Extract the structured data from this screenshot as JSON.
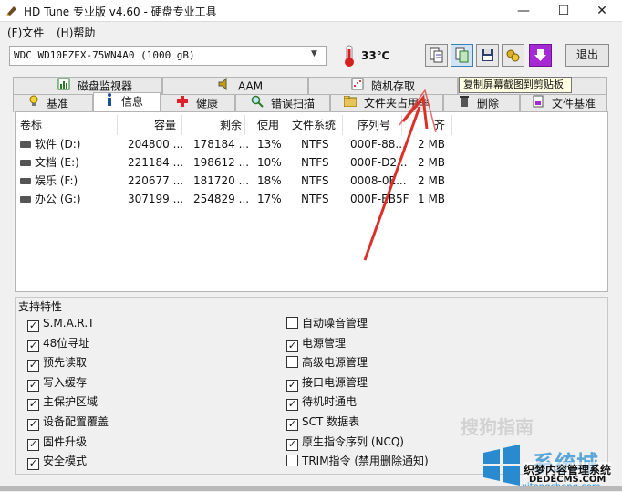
{
  "window": {
    "title": "HD Tune 专业版 v4.60 - 硬盘专业工具",
    "min": "—",
    "max": "☐",
    "close": "✕"
  },
  "menu": {
    "file": "(F)文件",
    "help": "(H)帮助"
  },
  "toolbar": {
    "drive": "WDC WD10EZEX-75WN4A0 (1000 gB)",
    "temperature": "33℃",
    "exit": "退出",
    "tooltip": "复制屏幕截图到剪贴板",
    "icons": [
      "copy-info-icon",
      "copy-screenshot-icon",
      "save-icon",
      "options-icon",
      "download-icon"
    ]
  },
  "tabs_row1": [
    "磁盘监视器",
    "AAM",
    "随机存取",
    "附加测试"
  ],
  "tabs_row2": [
    "基准",
    "信息",
    "健康",
    "错误扫描",
    "文件夹占用率",
    "删除",
    "文件基准"
  ],
  "table": {
    "headers": [
      "卷标",
      "容量",
      "剩余",
      "使用",
      "文件系统",
      "序列号",
      "簇大小"
    ],
    "header_visible": [
      "卷标",
      "容量",
      "剩余",
      "使用",
      "文件系统",
      "序列号",
      "齐"
    ],
    "rows": [
      [
        "软件 (D:)",
        "204800 ...",
        "178184 ...",
        "13%",
        "NTFS",
        "000F-88...",
        "2 MB"
      ],
      [
        "文档 (E:)",
        "221184 ...",
        "198612 ...",
        "10%",
        "NTFS",
        "000F-D2...",
        "2 MB"
      ],
      [
        "娱乐 (F:)",
        "220677 ...",
        "181720 ...",
        "18%",
        "NTFS",
        "0008-0E...",
        "2 MB"
      ],
      [
        "办公 (G:)",
        "307199 ...",
        "254829 ...",
        "17%",
        "NTFS",
        "000F-EB5F",
        "1 MB"
      ]
    ]
  },
  "features": {
    "title": "支持特性",
    "left": [
      {
        "label": "S.M.A.R.T",
        "checked": true
      },
      {
        "label": "48位寻址",
        "checked": true
      },
      {
        "label": "预先读取",
        "checked": true
      },
      {
        "label": "写入缓存",
        "checked": true
      },
      {
        "label": "主保护区域",
        "checked": true
      },
      {
        "label": "设备配置覆盖",
        "checked": true
      },
      {
        "label": "固件升级",
        "checked": true
      },
      {
        "label": "安全模式",
        "checked": true
      }
    ],
    "right": [
      {
        "label": "自动噪音管理",
        "checked": false
      },
      {
        "label": "电源管理",
        "checked": true
      },
      {
        "label": "高级电源管理",
        "checked": false
      },
      {
        "label": "接口电源管理",
        "checked": true
      },
      {
        "label": "待机时通电",
        "checked": true
      },
      {
        "label": "SCT 数据表",
        "checked": true
      },
      {
        "label": "原生指令序列 (NCQ)",
        "checked": true
      },
      {
        "label": "TRIM指令 (禁用删除通知)",
        "checked": false
      }
    ]
  },
  "watermark": {
    "sogou": "搜狗指南",
    "brand": "系统城",
    "line1": "织梦内容管理系统",
    "line2": "DEDECMS.COM",
    "line3": "xitongcheng.com"
  },
  "colors": {
    "annotation_arrow": "#d9302a",
    "health_cross": "#e0202a",
    "accent_blue": "#2a8ad0"
  }
}
